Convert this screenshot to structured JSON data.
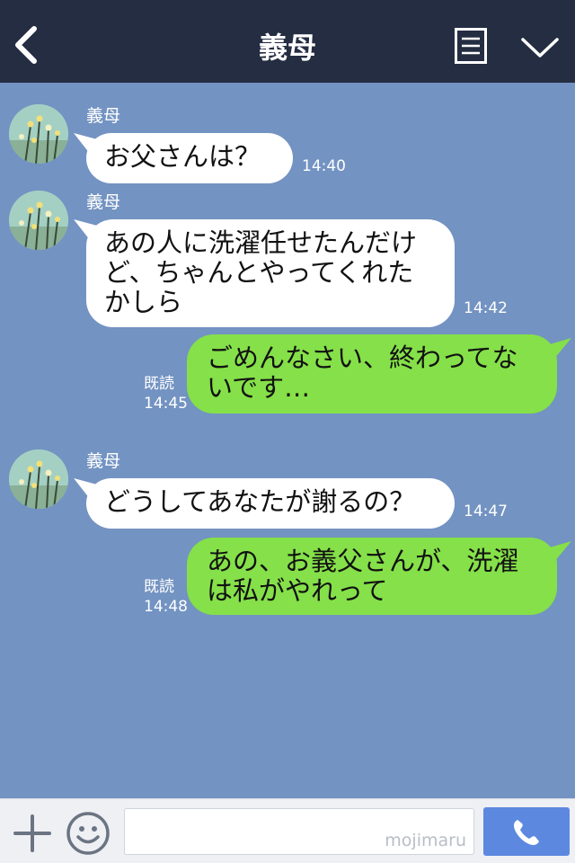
{
  "header": {
    "title": "義母",
    "back_icon": "chevron-left-icon",
    "menu_icon": "list-icon",
    "collapse_icon": "chevron-down-icon",
    "background": "#252d42"
  },
  "chat": {
    "background": "#7393c2",
    "messages": [
      {
        "direction": "in",
        "sender": "義母",
        "text": "お父さんは？",
        "time": "14:40"
      },
      {
        "direction": "in",
        "sender": "義母",
        "text": "あの人に洗濯任せたんだけ\nど、ちゃんとやってくれた\nかしら",
        "time": "14:42"
      },
      {
        "direction": "out",
        "text": "ごめんなさい、終わってな\nいです…",
        "read_label": "既読",
        "time": "14:45"
      },
      {
        "direction": "in",
        "sender": "義母",
        "text": "どうしてあなたが謝るの？",
        "time": "14:47"
      },
      {
        "direction": "out",
        "text": "あの、お義父さんが、洗濯\nは私がやれって",
        "read_label": "既読",
        "time": "14:48"
      }
    ]
  },
  "input_bar": {
    "watermark": "mojimaru",
    "plus_icon": "plus-icon",
    "emoji_icon": "smiley-icon",
    "call_icon": "phone-icon",
    "call_color": "#5d88e0"
  },
  "colors": {
    "incoming_bubble": "#ffffff",
    "outgoing_bubble": "#85e049"
  }
}
